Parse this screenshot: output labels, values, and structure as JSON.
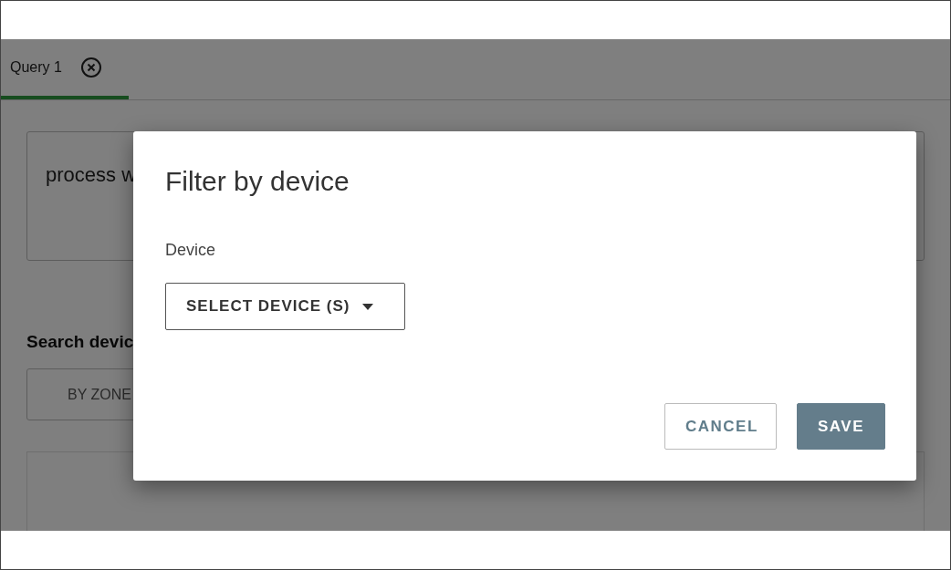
{
  "tabs": [
    {
      "label": "Query 1",
      "selected": true
    }
  ],
  "query": {
    "text": "process w"
  },
  "search": {
    "heading": "Search devic",
    "buttons": [
      "BY ZONE"
    ]
  },
  "dialog": {
    "title": "Filter by device",
    "field_label": "Device",
    "dropdown": "SELECT DEVICE (S)",
    "buttons": [
      {
        "label": "CANCEL",
        "kind": "outlined"
      },
      {
        "label": "SAVE",
        "kind": "filled"
      }
    ]
  }
}
